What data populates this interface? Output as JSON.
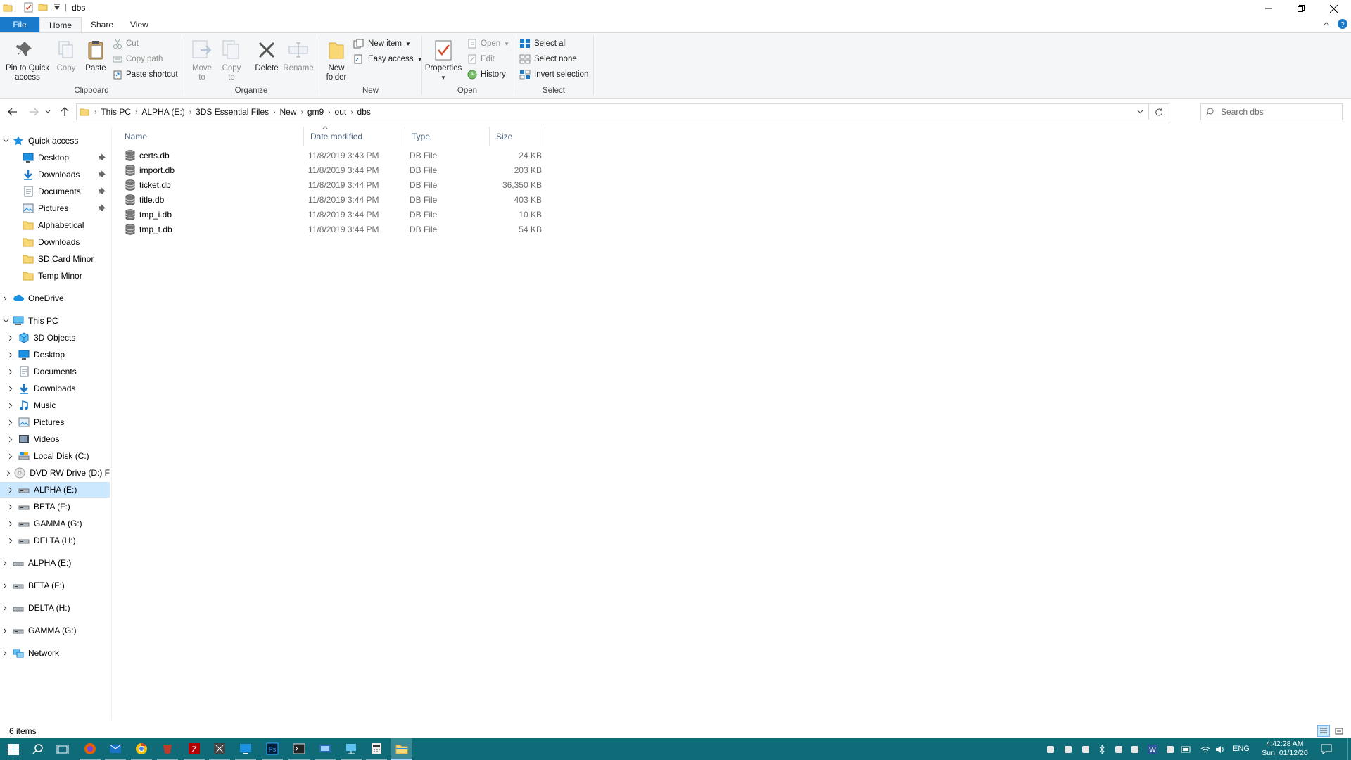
{
  "window": {
    "title": "dbs",
    "minimize_symbol": "—",
    "restore_symbol": "❐",
    "close_symbol": "✕"
  },
  "ribbon_tabs": {
    "file": "File",
    "home": "Home",
    "share": "Share",
    "view": "View"
  },
  "ribbon": {
    "clipboard": {
      "pin_line1": "Pin to Quick",
      "pin_line2": "access",
      "copy": "Copy",
      "paste": "Paste",
      "cut": "Cut",
      "copy_path": "Copy path",
      "paste_shortcut": "Paste shortcut",
      "label": "Clipboard"
    },
    "organize": {
      "move_line1": "Move",
      "move_line2": "to",
      "copy_line1": "Copy",
      "copy_line2": "to",
      "delete": "Delete",
      "rename": "Rename",
      "label": "Organize"
    },
    "new": {
      "new_folder_line1": "New",
      "new_folder_line2": "folder",
      "new_item": "New item",
      "easy_access": "Easy access",
      "label": "New"
    },
    "open": {
      "properties": "Properties",
      "open": "Open",
      "edit": "Edit",
      "history": "History",
      "label": "Open"
    },
    "select": {
      "select_all": "Select all",
      "select_none": "Select none",
      "invert_selection": "Invert selection",
      "label": "Select"
    }
  },
  "address": {
    "crumbs": [
      "This PC",
      "ALPHA (E:)",
      "3DS Essential Files",
      "New",
      "gm9",
      "out",
      "dbs"
    ],
    "search_placeholder": "Search dbs"
  },
  "nav": {
    "quick_access": "Quick access",
    "quick_items": [
      {
        "label": "Desktop",
        "icon": "desktop-icon",
        "pinned": true
      },
      {
        "label": "Downloads",
        "icon": "download-icon",
        "pinned": true
      },
      {
        "label": "Documents",
        "icon": "documents-icon",
        "pinned": true
      },
      {
        "label": "Pictures",
        "icon": "pictures-icon",
        "pinned": true
      },
      {
        "label": "Alphabetical",
        "icon": "folder-icon",
        "pinned": false
      },
      {
        "label": "Downloads",
        "icon": "folder-icon",
        "pinned": false
      },
      {
        "label": "SD Card Minor",
        "icon": "folder-icon",
        "pinned": false
      },
      {
        "label": "Temp Minor",
        "icon": "folder-icon",
        "pinned": false
      }
    ],
    "onedrive": "OneDrive",
    "this_pc": "This PC",
    "pc_items": [
      {
        "label": "3D Objects",
        "icon": "3d-objects-icon"
      },
      {
        "label": "Desktop",
        "icon": "desktop-icon"
      },
      {
        "label": "Documents",
        "icon": "documents-icon"
      },
      {
        "label": "Downloads",
        "icon": "download-icon"
      },
      {
        "label": "Music",
        "icon": "music-icon"
      },
      {
        "label": "Pictures",
        "icon": "pictures-icon"
      },
      {
        "label": "Videos",
        "icon": "videos-icon"
      },
      {
        "label": "Local Disk (C:)",
        "icon": "local-disk-icon"
      },
      {
        "label": "DVD RW Drive (D:) F",
        "icon": "dvd-drive-icon"
      },
      {
        "label": "ALPHA (E:)",
        "icon": "drive-icon"
      },
      {
        "label": "BETA (F:)",
        "icon": "drive-icon"
      },
      {
        "label": "GAMMA (G:)",
        "icon": "drive-icon"
      },
      {
        "label": "DELTA (H:)",
        "icon": "drive-icon"
      }
    ],
    "drives": [
      "ALPHA (E:)",
      "BETA (F:)",
      "DELTA (H:)",
      "GAMMA (G:)"
    ],
    "network": "Network"
  },
  "columns": {
    "name": "Name",
    "date": "Date modified",
    "type": "Type",
    "size": "Size"
  },
  "files": [
    {
      "name": "certs.db",
      "date": "11/8/2019 3:43 PM",
      "type": "DB File",
      "size": "24 KB"
    },
    {
      "name": "import.db",
      "date": "11/8/2019 3:44 PM",
      "type": "DB File",
      "size": "203 KB"
    },
    {
      "name": "ticket.db",
      "date": "11/8/2019 3:44 PM",
      "type": "DB File",
      "size": "36,350 KB"
    },
    {
      "name": "title.db",
      "date": "11/8/2019 3:44 PM",
      "type": "DB File",
      "size": "403 KB"
    },
    {
      "name": "tmp_i.db",
      "date": "11/8/2019 3:44 PM",
      "type": "DB File",
      "size": "10 KB"
    },
    {
      "name": "tmp_t.db",
      "date": "11/8/2019 3:44 PM",
      "type": "DB File",
      "size": "54 KB"
    }
  ],
  "status": {
    "item_count": "6 items"
  },
  "taskbar": {
    "apps": [
      "start-icon",
      "search-icon",
      "task-view-icon",
      "firefox-icon",
      "thunderbird-icon",
      "chrome-icon",
      "brave-icon",
      "filezilla-icon",
      "explorer-alt-icon",
      "desktop-app-icon",
      "photoshop-icon",
      "terminal-icon",
      "remote-desktop-icon",
      "network-app-icon",
      "calculator-icon",
      "file-explorer-icon"
    ],
    "language": "ENG",
    "time": "4:42:28 AM",
    "date": "Sun, 01/12/20"
  }
}
